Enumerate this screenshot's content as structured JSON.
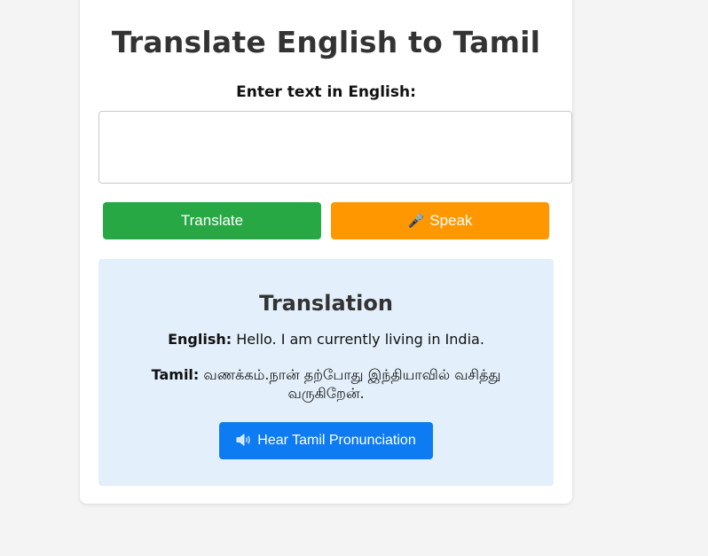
{
  "app": {
    "title": "Translate English to Tamil"
  },
  "input": {
    "label": "Enter text in English:",
    "value": "",
    "placeholder": ""
  },
  "buttons": {
    "translate_label": "Translate",
    "speak_label": "Speak",
    "speak_icon": "microphone-icon",
    "hear_label": "Hear Tamil Pronunciation",
    "hear_icon": "speaker-icon"
  },
  "result": {
    "title": "Translation",
    "english_label": "English:",
    "english_text": "Hello. I am currently living in India.",
    "tamil_label": "Tamil:",
    "tamil_text": "வணக்கம்.நான் தற்போது இந்தியாவில் வசித்து வருகிறேன்."
  },
  "colors": {
    "translate_button": "#28a745",
    "speak_button": "#ff9800",
    "hear_button": "#0d7cf2",
    "result_background": "#e3f0fb",
    "page_background": "#f4f4f4"
  }
}
